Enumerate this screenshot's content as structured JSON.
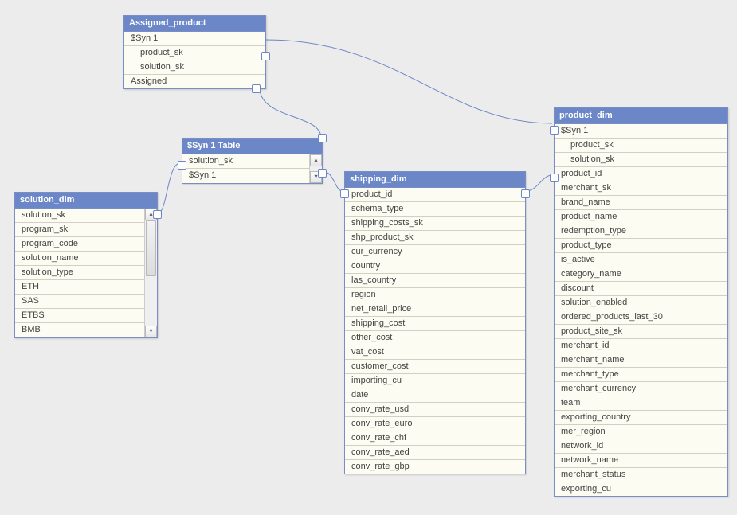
{
  "tables": {
    "assigned_product": {
      "title": "Assigned_product",
      "fields": [
        "$Syn 1",
        "product_sk",
        "solution_sk",
        "Assigned"
      ],
      "indent": [
        false,
        true,
        true,
        false
      ]
    },
    "ssyn1": {
      "title": "$Syn 1 Table",
      "fields": [
        "solution_sk",
        "$Syn 1"
      ],
      "indent": [
        false,
        false
      ]
    },
    "solution_dim": {
      "title": "solution_dim",
      "fields": [
        "solution_sk",
        "program_sk",
        "program_code",
        "solution_name",
        "solution_type",
        "ETH",
        "SAS",
        "ETBS",
        "BMB"
      ],
      "indent": [
        false,
        false,
        false,
        false,
        false,
        false,
        false,
        false,
        false
      ]
    },
    "shipping_dim": {
      "title": "shipping_dim",
      "fields": [
        "product_id",
        "schema_type",
        "shipping_costs_sk",
        "shp_product_sk",
        "cur_currency",
        "country",
        "las_country",
        "region",
        "net_retail_price",
        "shipping_cost",
        "other_cost",
        "vat_cost",
        "customer_cost",
        "importing_cu",
        "date",
        "conv_rate_usd",
        "conv_rate_euro",
        "conv_rate_chf",
        "conv_rate_aed",
        "conv_rate_gbp"
      ],
      "indent": [
        false,
        false,
        false,
        false,
        false,
        false,
        false,
        false,
        false,
        false,
        false,
        false,
        false,
        false,
        false,
        false,
        false,
        false,
        false,
        false
      ]
    },
    "product_dim": {
      "title": "product_dim",
      "fields": [
        "$Syn 1",
        "product_sk",
        "solution_sk",
        "product_id",
        "merchant_sk",
        "brand_name",
        "product_name",
        "redemption_type",
        "product_type",
        "is_active",
        "category_name",
        "discount",
        "solution_enabled",
        "ordered_products_last_30",
        "product_site_sk",
        "merchant_id",
        "merchant_name",
        "merchant_type",
        "merchant_currency",
        "team",
        "exporting_country",
        "mer_region",
        "network_id",
        "network_name",
        "merchant_status",
        "exporting_cu"
      ],
      "indent": [
        false,
        true,
        true,
        false,
        false,
        false,
        false,
        false,
        false,
        false,
        false,
        false,
        false,
        false,
        false,
        false,
        false,
        false,
        false,
        false,
        false,
        false,
        false,
        false,
        false,
        false
      ]
    }
  },
  "colors": {
    "header_bg": "#6b87c8",
    "border": "#7a8ec5",
    "body_bg": "#fcfcf2",
    "canvas_bg": "#ececec",
    "line": "#6b87c8"
  }
}
